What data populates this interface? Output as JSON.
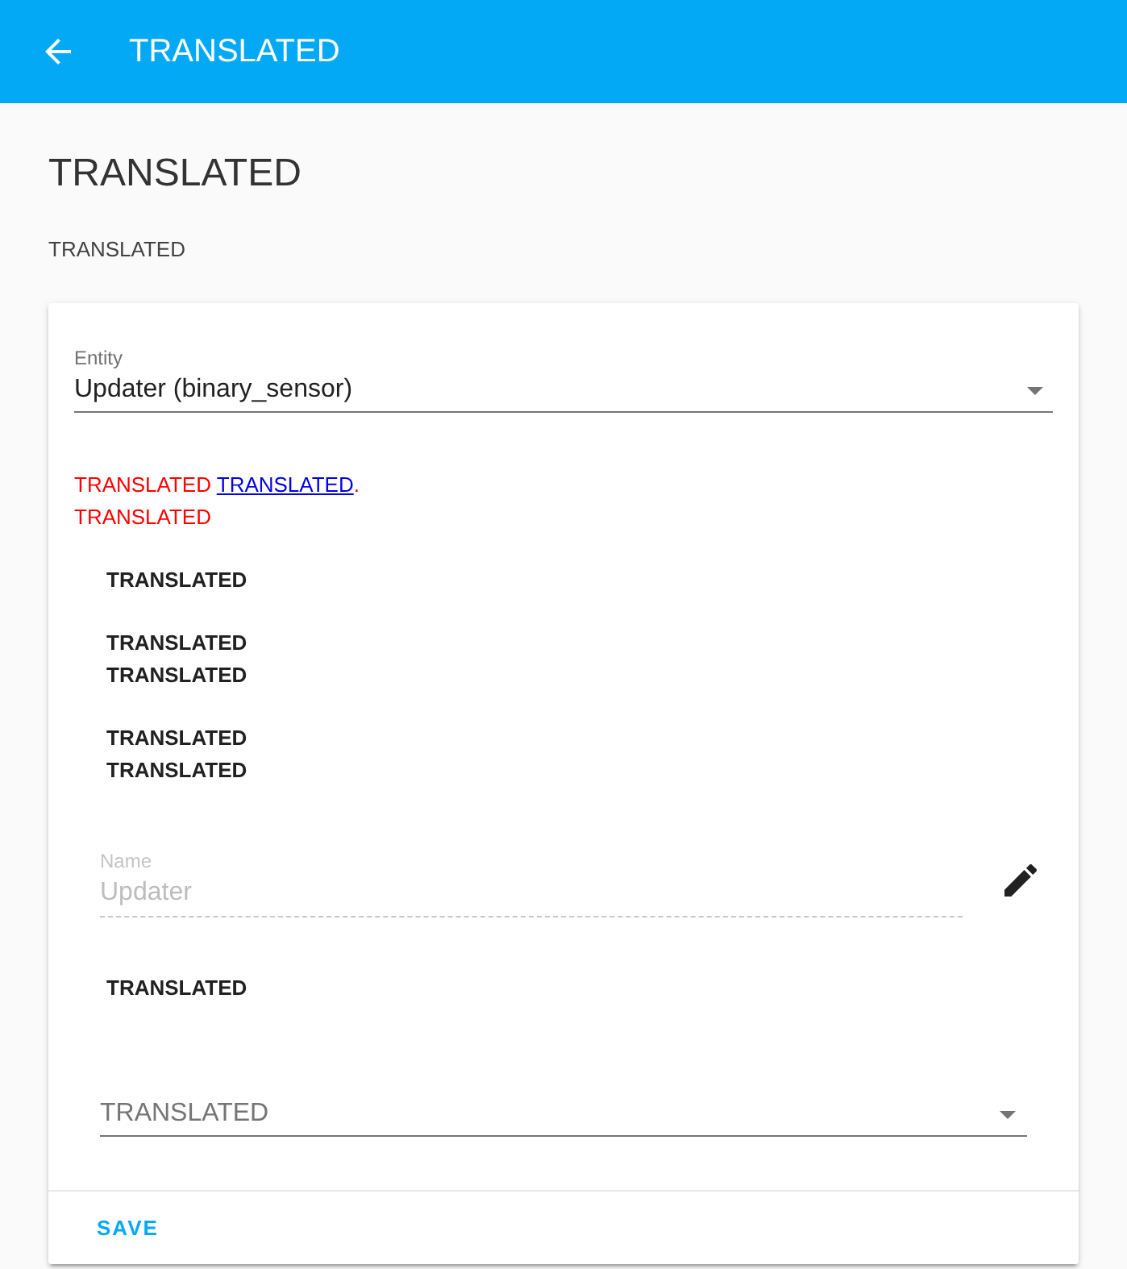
{
  "header": {
    "title": "TRANSLATED"
  },
  "page": {
    "heading": "TRANSLATED",
    "description": "TRANSLATED"
  },
  "card": {
    "entity_select": {
      "label": "Entity",
      "value": "Updater (binary_sensor)"
    },
    "warning": {
      "text": "TRANSLATED",
      "link": "TRANSLATED",
      "after_link": ".",
      "second_line": "TRANSLATED"
    },
    "info_groups": [
      {
        "lines": [
          "TRANSLATED"
        ]
      },
      {
        "lines": [
          "TRANSLATED",
          "TRANSLATED"
        ]
      },
      {
        "lines": [
          "TRANSLATED",
          "TRANSLATED"
        ]
      }
    ],
    "name_field": {
      "label": "Name",
      "value": "Updater",
      "disabled": true
    },
    "note": "TRANSLATED",
    "dropdown": {
      "label": "TRANSLATED"
    },
    "actions": [
      {
        "label": "SAVE"
      }
    ]
  }
}
